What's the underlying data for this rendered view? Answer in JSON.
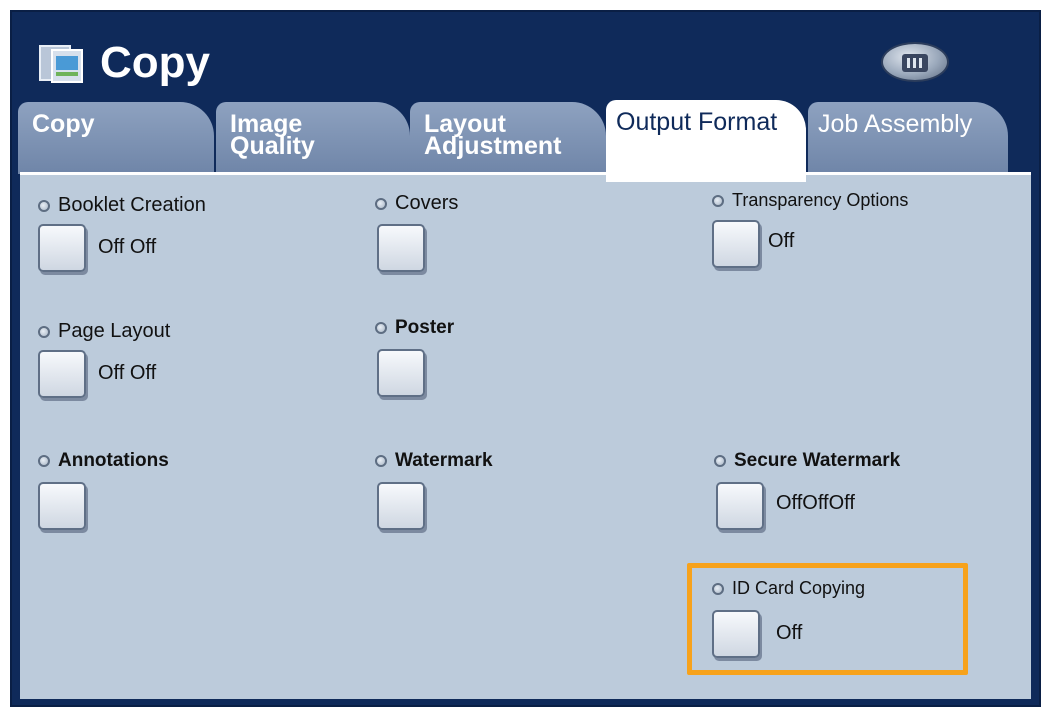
{
  "app": {
    "title": "Copy",
    "icon": "copy-app-icon",
    "menu_icon": "menu-icon"
  },
  "tabs": [
    {
      "line1": "Copy",
      "line2": ""
    },
    {
      "line1": "Image",
      "line2": "Quality"
    },
    {
      "line1": "Layout",
      "line2": "Adjustment"
    },
    {
      "line1": "Output Format",
      "line2": ""
    },
    {
      "line1": "Job Assembly",
      "line2": ""
    }
  ],
  "active_tab": "Output Format",
  "options": {
    "booklet": {
      "label": "Booklet Creation",
      "value": "Off Off"
    },
    "covers": {
      "label": "Covers",
      "value": ""
    },
    "transparency": {
      "label": "Transparency Options",
      "value": "Off"
    },
    "page_layout": {
      "label": "Page Layout",
      "value": "Off Off"
    },
    "poster": {
      "label": "Poster",
      "value": ""
    },
    "annotations": {
      "label": "Annotations",
      "value": ""
    },
    "watermark": {
      "label": "Watermark",
      "value": ""
    },
    "secure_watermark": {
      "label": "Secure Watermark",
      "value": "OffOffOff"
    },
    "id_card": {
      "label": "ID Card Copying",
      "value": "Off"
    }
  },
  "colors": {
    "frame": "#0f2a5a",
    "panel": "#bccbdb",
    "tab": "#7f94b4",
    "highlight": "#f7a21b"
  }
}
